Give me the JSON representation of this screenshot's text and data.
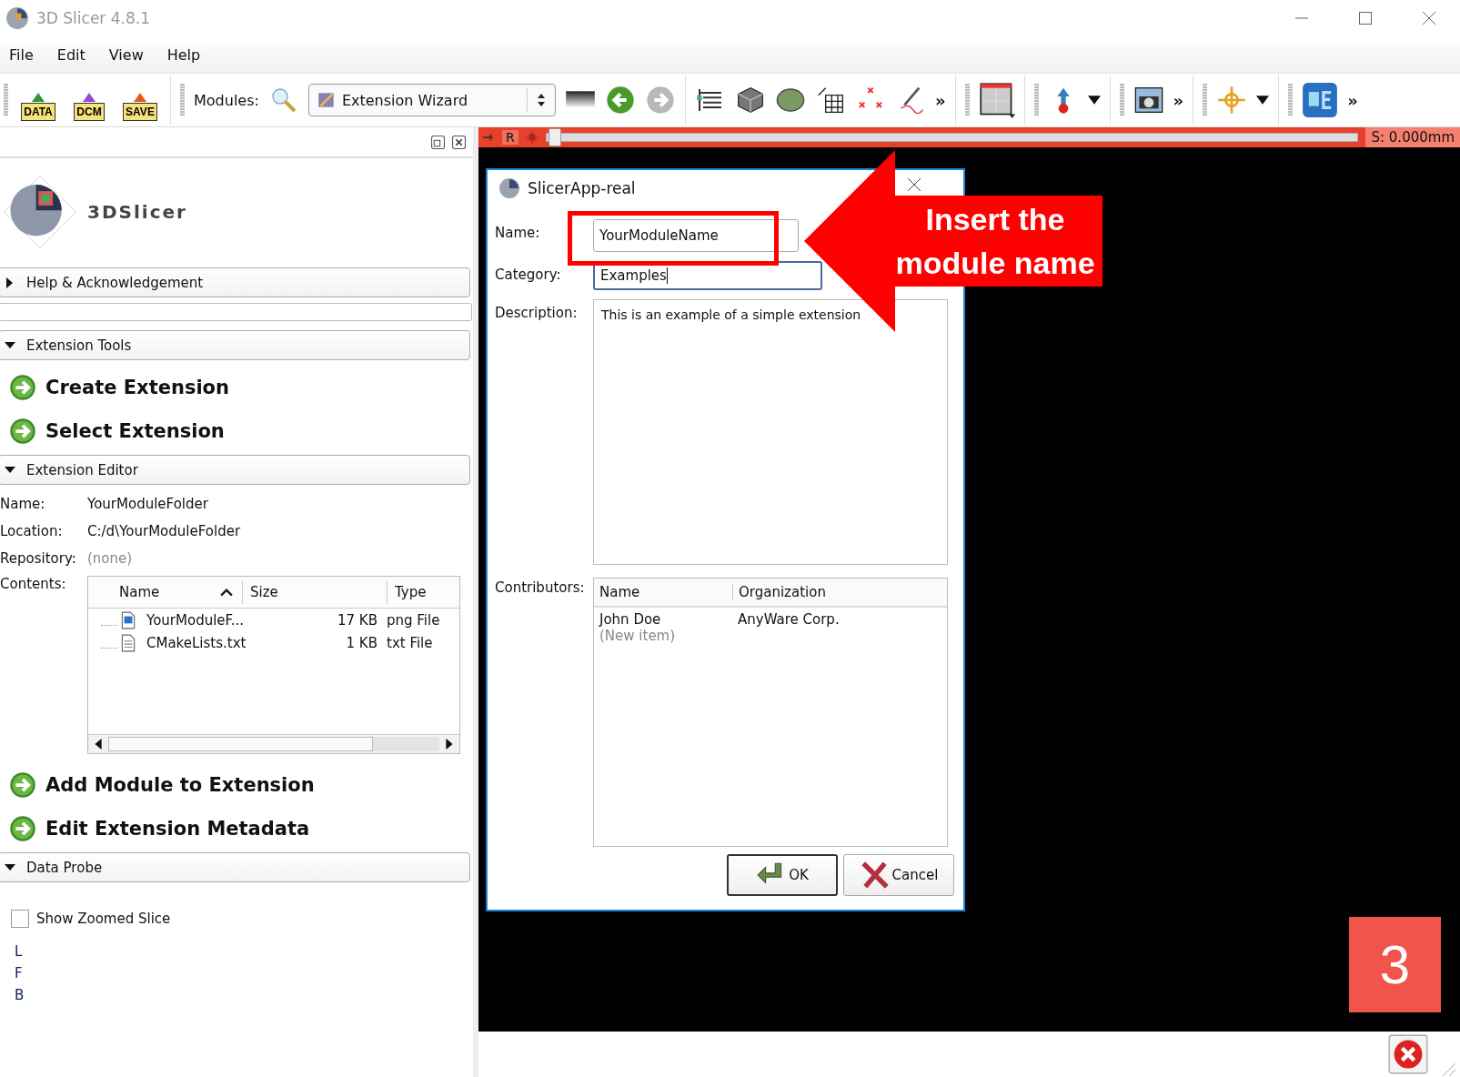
{
  "window": {
    "title": "3D Slicer 4.8.1"
  },
  "menu": [
    "File",
    "Edit",
    "View",
    "Help"
  ],
  "toolbar": {
    "file_buttons": [
      "DATA",
      "DCM",
      "SAVE"
    ],
    "modules_label": "Modules:",
    "module_select": "Extension Wizard",
    "back_enabled": true,
    "forward_enabled": false,
    "chevrons": [
      "»",
      "»",
      "»"
    ]
  },
  "slice_bar": {
    "orientation": "R",
    "offset": "S: 0.000mm"
  },
  "panel": {
    "logo_text": "3DSlicer",
    "sections": [
      {
        "kind": "header",
        "label": "Help & Acknowledgement",
        "expanded": false
      },
      {
        "kind": "blank"
      },
      {
        "kind": "header",
        "label": "Extension Tools",
        "expanded": true
      },
      {
        "kind": "action",
        "label": "Create Extension"
      },
      {
        "kind": "action",
        "label": "Select Extension"
      },
      {
        "kind": "header",
        "label": "Extension Editor",
        "expanded": true
      },
      {
        "kind": "field",
        "label": "Name:",
        "value": "YourModuleFolder",
        "muted": false
      },
      {
        "kind": "field",
        "label": "Location:",
        "value": "C:/d\\YourModuleFolder",
        "muted": false
      },
      {
        "kind": "field",
        "label": "Repository:",
        "value": "(none)",
        "muted": true
      },
      {
        "kind": "table",
        "label": "Contents:",
        "columns": [
          {
            "label": "Name",
            "sorted": true
          },
          {
            "label": "Size",
            "sorted": false
          },
          {
            "label": "Type",
            "sorted": false
          }
        ],
        "rows": [
          {
            "kind": "image",
            "name": "YourModuleF...",
            "size": "17 KB",
            "type": "png File"
          },
          {
            "kind": "text",
            "name": "CMakeLists.txt",
            "size": "1 KB",
            "type": "txt File"
          }
        ]
      },
      {
        "kind": "action",
        "label": "Add Module to Extension"
      },
      {
        "kind": "action",
        "label": "Edit Extension Metadata"
      },
      {
        "kind": "header",
        "label": "Data Probe",
        "expanded": true
      },
      {
        "kind": "checkbox",
        "label": "Show Zoomed Slice",
        "checked": false
      },
      {
        "kind": "probe",
        "labels": [
          "L",
          "F",
          "B"
        ]
      }
    ]
  },
  "dialog": {
    "title": "SlicerApp-real",
    "name_label": "Name:",
    "name_value": "YourModuleName",
    "category_label": "Category:",
    "category_value": "Examples",
    "category_focused": true,
    "description_label": "Description:",
    "description_value": "This is an example of a simple extension",
    "contributors_label": "Contributors:",
    "contributor_columns": [
      "Name",
      "Organization"
    ],
    "contributors": [
      {
        "name": "John Doe",
        "organization": "AnyWare Corp."
      }
    ],
    "new_item": "(New item)",
    "buttons": [
      {
        "kind": "ok",
        "label": "OK",
        "default": true
      },
      {
        "kind": "cancel",
        "label": "Cancel",
        "default": false
      }
    ]
  },
  "annotation": {
    "callout": [
      "Insert the",
      "module name"
    ],
    "step": "3"
  }
}
